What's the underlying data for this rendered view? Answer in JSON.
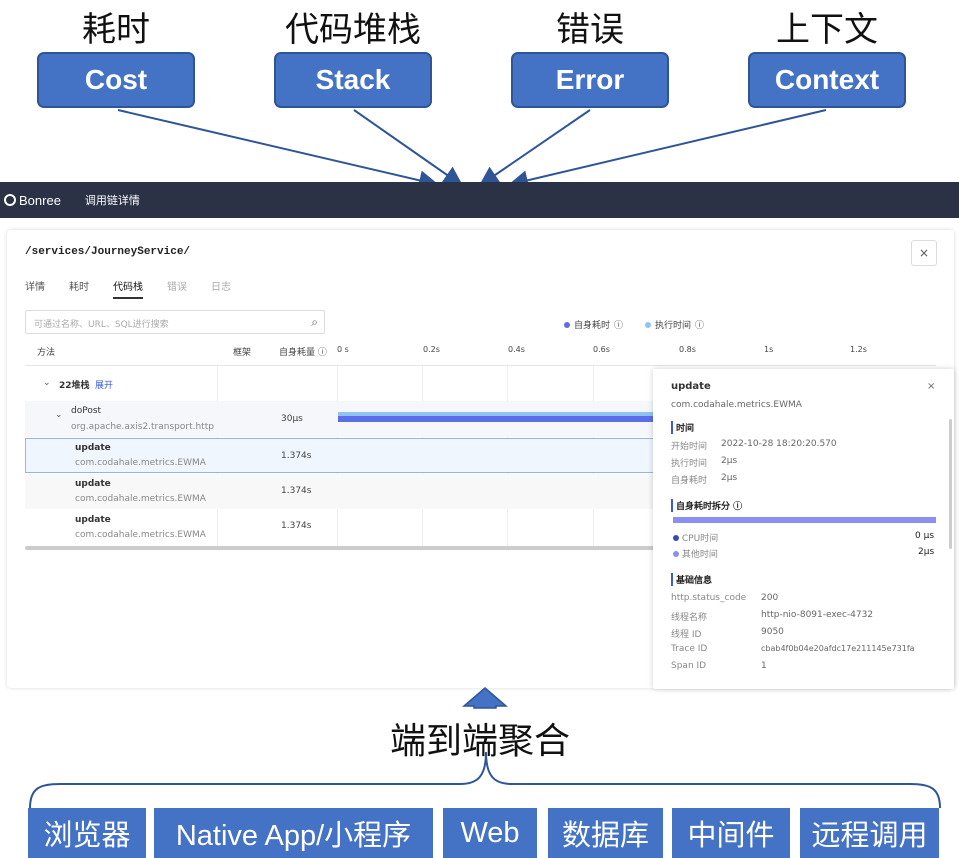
{
  "concepts": [
    {
      "title": "耗时",
      "label": "Cost"
    },
    {
      "title": "代码堆栈",
      "label": "Stack"
    },
    {
      "title": "错误",
      "label": "Error"
    },
    {
      "title": "上下文",
      "label": "Context"
    }
  ],
  "colors": {
    "accent": "#4472c4",
    "accent_border": "#2f5597",
    "appbar": "#2b3245",
    "self_time": "#5b6ee8",
    "exec_time": "#8fc3f2"
  },
  "app": {
    "brand": "Bonree",
    "title": "调用链详情"
  },
  "panel": {
    "path": "/services/JourneyService/",
    "close": "×",
    "tabs": [
      "详情",
      "耗时",
      "代码栈",
      "错误",
      "日志"
    ],
    "search_placeholder": "可通过名称、URL、SQL进行搜索",
    "legend": {
      "self": "自身耗时",
      "exec": "执行时间"
    },
    "columns": {
      "method": "方法",
      "frame": "框架",
      "self": "自身耗量"
    },
    "ticks": [
      "0 s",
      "0.2s",
      "0.4s",
      "0.6s",
      "0.8s",
      "1s",
      "1.2s"
    ],
    "stack_count": "22堆栈",
    "expand": "展开",
    "rows": [
      {
        "name": "doPost",
        "sub": "org.apache.axis2.transport.http",
        "value": "30μs"
      },
      {
        "name": "update",
        "sub": "com.codahale.metrics.EWMA",
        "value": "1.374s"
      },
      {
        "name": "update",
        "sub": "com.codahale.metrics.EWMA",
        "value": "1.374s"
      },
      {
        "name": "update",
        "sub": "com.codahale.metrics.EWMA",
        "value": "1.374s"
      }
    ]
  },
  "popover": {
    "title": "update",
    "subtitle": "com.codahale.metrics.EWMA",
    "close": "×",
    "time_section": "时间",
    "time_rows": [
      {
        "k": "开始时间",
        "v": "2022-10-28 18:20:20.570"
      },
      {
        "k": "执行时间",
        "v": "2μs"
      },
      {
        "k": "自身耗时",
        "v": "2μs"
      }
    ],
    "breakdown_section": "自身耗时拆分",
    "cpu_label": "CPU时间",
    "cpu_value": "0 μs",
    "other_label": "其他时间",
    "other_value": "2μs",
    "info_section": "基础信息",
    "info_rows": [
      {
        "k": "http.status_code",
        "v": "200"
      },
      {
        "k": "线程名称",
        "v": "http-nio-8091-exec-4732"
      },
      {
        "k": "线程 ID",
        "v": "9050"
      },
      {
        "k": "Trace ID",
        "v": "cbab4f0b04e20afdc17e211145e731fa"
      },
      {
        "k": "Span ID",
        "v": "1"
      }
    ]
  },
  "aggregation": "端到端聚合",
  "sources": [
    "浏览器",
    "Native App/小程序",
    "Web",
    "数据库",
    "中间件",
    "远程调用"
  ]
}
